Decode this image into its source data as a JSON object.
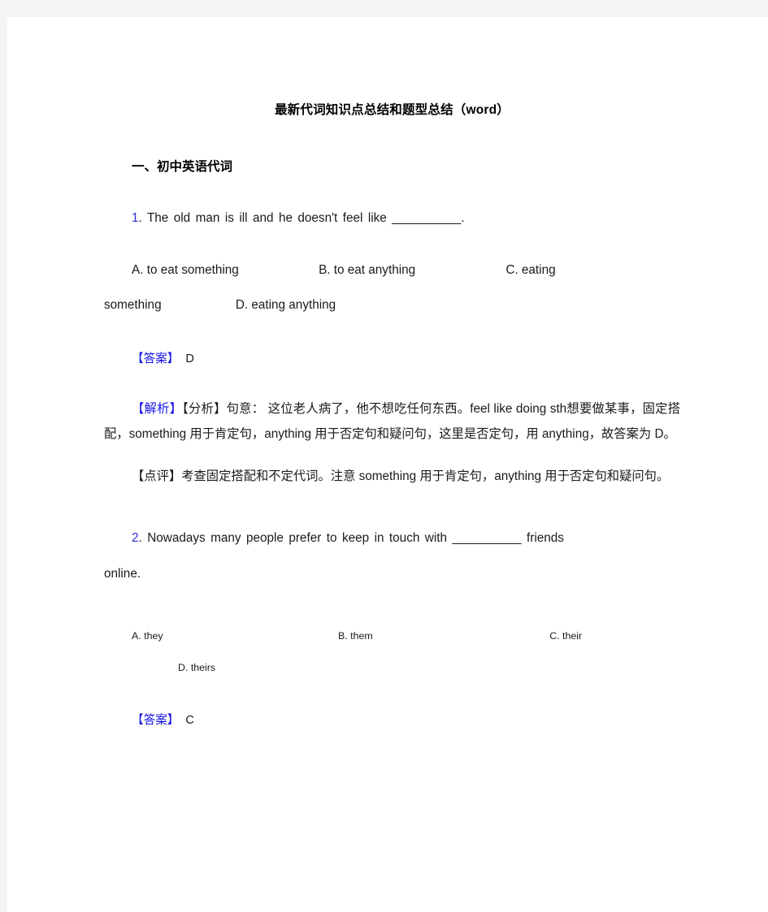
{
  "document": {
    "title": "最新代词知识点总结和题型总结（word）",
    "section_heading": "一、初中英语代词",
    "colors": {
      "page_background": "#ffffff",
      "canvas_background": "#f4f4f4",
      "text": "#1a1a1a",
      "accent_blue": "#1414e6",
      "number_blue": "#2b2bd4"
    }
  },
  "questions": [
    {
      "number": "1",
      "number_dot": ".",
      "stem": "The old man is ill and he doesn't feel like",
      "blank": "__________",
      "stem_end": ".",
      "options": {
        "a": "A. to    eat    something",
        "b": "B. to    eat    anything",
        "c": "C. eating",
        "c_wrap": "something",
        "d": "D. eating anything"
      },
      "answer_label": "【答案】",
      "answer_value": "D",
      "explain_tag_blue": "【解析】",
      "explain_tag_dark": "【分析】",
      "explain_body": "句意： 这位老人病了，他不想吃任何东西。feel like doing sth想要做某事，固定搭配，something 用于肯定句，anything 用于否定句和疑问句，这里是否定句，用 anything，故答案为 D。",
      "comment_tag": "【点评】",
      "comment_body": "考查固定搭配和不定代词。注意 something 用于肯定句，anything 用于否定句和疑问句。"
    },
    {
      "number": "2",
      "number_dot": ".",
      "stem": "Nowadays many people prefer to keep in touch with",
      "blank": "__________",
      "stem_end": "friends",
      "stem_wrap": "online.",
      "options": {
        "a": "A. they",
        "b": "B. them",
        "c": "C. their",
        "d": "D. theirs"
      },
      "answer_label": "【答案】",
      "answer_value": "C"
    }
  ]
}
